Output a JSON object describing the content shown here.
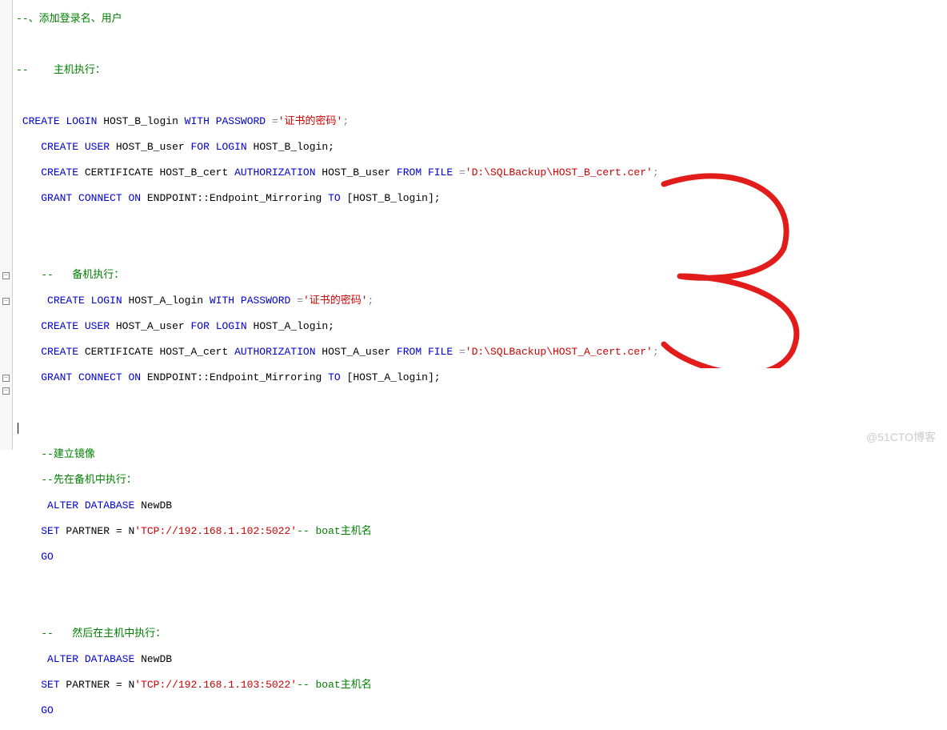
{
  "lines": {
    "l1a": "--",
    "l1b": "、添加登录名、用户",
    "l2a": "--",
    "l2b": "    主机执行：",
    "l3a": " ",
    "l3b": "CREATE",
    "l3c": " ",
    "l3d": "LOGIN",
    "l3e": " HOST_B_login ",
    "l3f": "WITH",
    "l3g": " ",
    "l3h": "PASSWORD",
    "l3i": " =",
    "l3j": "'证书的密码'",
    "l3k": ";",
    "l4a": "    ",
    "l4b": "CREATE",
    "l4c": " ",
    "l4d": "USER",
    "l4e": " HOST_B_user ",
    "l4f": "FOR",
    "l4g": " ",
    "l4h": "LOGIN",
    "l4i": " HOST_B_login;",
    "l5a": "    ",
    "l5b": "CREATE",
    "l5c": " CERTIFICATE HOST_B_cert ",
    "l5d": "AUTHORIZATION",
    "l5e": " HOST_B_user ",
    "l5f": "FROM",
    "l5g": " ",
    "l5h": "FILE",
    "l5i": " =",
    "l5j": "'D:\\SQLBackup\\HOST_B_cert.cer'",
    "l5k": ";",
    "l6a": "    ",
    "l6b": "GRANT",
    "l6c": " ",
    "l6d": "CONNECT",
    "l6e": " ",
    "l6f": "ON",
    "l6g": " ENDPOINT::Endpoint_Mirroring ",
    "l6h": "TO",
    "l6i": " [HOST_B_login];",
    "l7a": "    ",
    "l7b": "--",
    "l7c": "   备机执行：",
    "l8a": "     ",
    "l8b": "CREATE",
    "l8c": " ",
    "l8d": "LOGIN",
    "l8e": " HOST_A_login ",
    "l8f": "WITH",
    "l8g": " ",
    "l8h": "PASSWORD",
    "l8i": " =",
    "l8j": "'证书的密码'",
    "l8k": ";",
    "l9a": "    ",
    "l9b": "CREATE",
    "l9c": " ",
    "l9d": "USER",
    "l9e": " HOST_A_user ",
    "l9f": "FOR",
    "l9g": " ",
    "l9h": "LOGIN",
    "l9i": " HOST_A_login;",
    "l10a": "    ",
    "l10b": "CREATE",
    "l10c": " CERTIFICATE HOST_A_cert ",
    "l10d": "AUTHORIZATION",
    "l10e": " HOST_A_user ",
    "l10f": "FROM",
    "l10g": " ",
    "l10h": "FILE",
    "l10i": " =",
    "l10j": "'D:\\SQLBackup\\HOST_A_cert.cer'",
    "l10k": ";",
    "l11a": "    ",
    "l11b": "GRANT",
    "l11c": " ",
    "l11d": "CONNECT",
    "l11e": " ",
    "l11f": "ON",
    "l11g": " ENDPOINT::Endpoint_Mirroring ",
    "l11h": "TO",
    "l11i": " [HOST_A_login];",
    "l12a": "    ",
    "l12b": "--建立镜像",
    "l13a": "    ",
    "l13b": "--先在备机中执行：",
    "l14a": "     ",
    "l14b": "ALTER",
    "l14c": " ",
    "l14d": "DATABASE",
    "l14e": " NewDB",
    "l15a": "    ",
    "l15b": "SET",
    "l15c": " PARTNER = N",
    "l15d": "'TCP://192.168.1.102:5022'",
    "l15e": "-- boat主机名",
    "l16a": "    ",
    "l16b": "GO",
    "l17a": "    ",
    "l17b": "--",
    "l17c": "   然后在主机中执行：",
    "l18a": "     ",
    "l18b": "ALTER",
    "l18c": " ",
    "l18d": "DATABASE",
    "l18e": " NewDB",
    "l19a": "    ",
    "l19b": "SET",
    "l19c": " PARTNER = N",
    "l19d": "'TCP://192.168.1.103:5022'",
    "l19e": "-- boat主机名",
    "l20a": "    ",
    "l20b": "GO"
  },
  "watermark": "@51CTO博客",
  "fold_glyph": "−"
}
